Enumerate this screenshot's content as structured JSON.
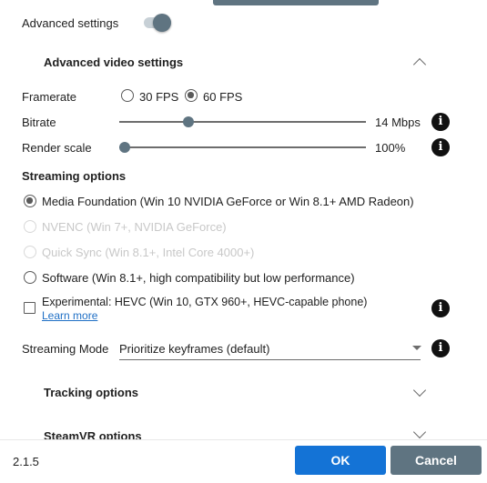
{
  "advanced_settings": {
    "label": "Advanced settings",
    "enabled": true
  },
  "video_section": {
    "title": "Advanced video settings",
    "framerate": {
      "label": "Framerate",
      "options": [
        "30 FPS",
        "60 FPS"
      ],
      "selected": "60 FPS"
    },
    "bitrate": {
      "label": "Bitrate",
      "value_text": "14 Mbps",
      "level": 0.27
    },
    "render_scale": {
      "label": "Render scale",
      "value_text": "100%",
      "level": 0.0
    }
  },
  "streaming": {
    "title": "Streaming options",
    "options": [
      {
        "label": "Media Foundation (Win 10 NVIDIA GeForce or Win 8.1+ AMD Radeon)",
        "checked": true,
        "disabled": false
      },
      {
        "label": "NVENC (Win 7+, NVIDIA GeForce)",
        "checked": false,
        "disabled": true
      },
      {
        "label": "Quick Sync (Win 8.1+, Intel Core 4000+)",
        "checked": false,
        "disabled": true
      },
      {
        "label": "Software (Win 8.1+, high compatibility but low performance)",
        "checked": false,
        "disabled": false
      }
    ],
    "experimental": {
      "label": "Experimental: HEVC (Win 10, GTX 960+, HEVC-capable phone)",
      "link": "Learn more",
      "checked": false
    },
    "mode": {
      "label": "Streaming Mode",
      "value": "Prioritize keyframes (default)"
    }
  },
  "tracking_section": {
    "title": "Tracking options"
  },
  "steamvr_section": {
    "title": "SteamVR options"
  },
  "footer": {
    "version": "2.1.5",
    "ok": "OK",
    "cancel": "Cancel"
  },
  "colors": {
    "accent": "#1473d6",
    "slate": "#5f7481"
  }
}
